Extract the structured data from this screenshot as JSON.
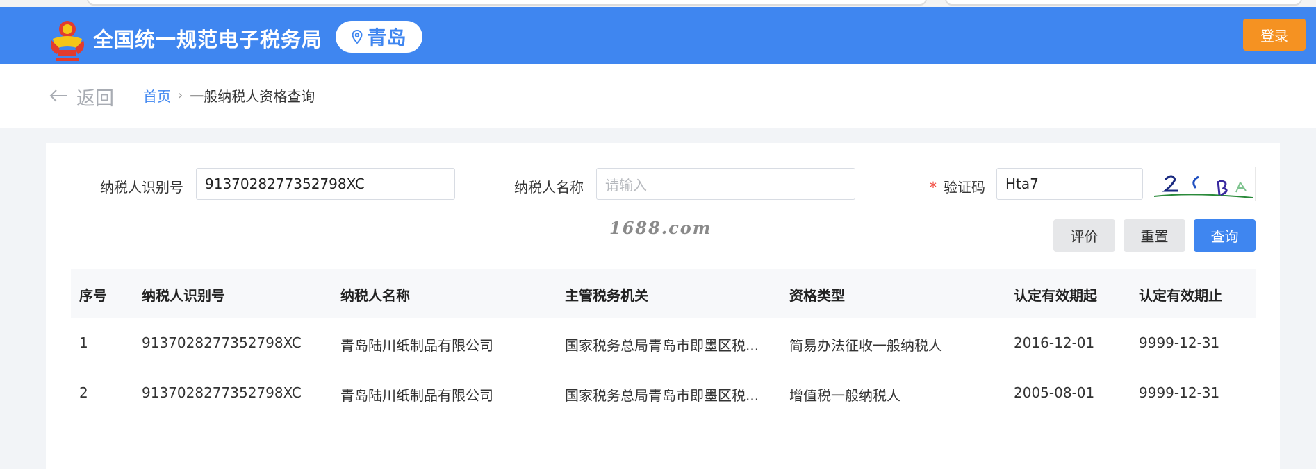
{
  "header": {
    "site_title": "全国统一规范电子税务局",
    "city": "青岛",
    "login_label": "登录",
    "colors": {
      "brand": "#3f86f0",
      "login": "#f59222"
    }
  },
  "breadcrumb": {
    "back_label": "返回",
    "home": "首页",
    "separator": "›",
    "current": "一般纳税人资格查询"
  },
  "form": {
    "taxpayer_id_label": "纳税人识别号",
    "taxpayer_id_value": "913702827735279​8XC",
    "taxpayer_name_label": "纳税人名称",
    "taxpayer_name_placeholder": "请输入",
    "captcha_required_mark": "*",
    "captcha_label": "验证码",
    "captcha_value": "Hta7",
    "captcha_image_text": "2CBA"
  },
  "watermark": "1688.com",
  "actions": {
    "evaluate": "评价",
    "reset": "重置",
    "query": "查询"
  },
  "table": {
    "columns": [
      "序号",
      "纳税人识别号",
      "纳税人名称",
      "主管税务机关",
      "资格类型",
      "认定有效期起",
      "认定有效期止"
    ],
    "rows": [
      [
        "1",
        "9137028277352798XC",
        "青岛陆川纸制品有限公司",
        "国家税务总局青岛市即墨区税...",
        "简易办法征收一般纳税人",
        "2016-12-01",
        "9999-12-31"
      ],
      [
        "2",
        "9137028277352798XC",
        "青岛陆川纸制品有限公司",
        "国家税务总局青岛市即墨区税...",
        "增值税一般纳税人",
        "2005-08-01",
        "9999-12-31"
      ]
    ]
  }
}
